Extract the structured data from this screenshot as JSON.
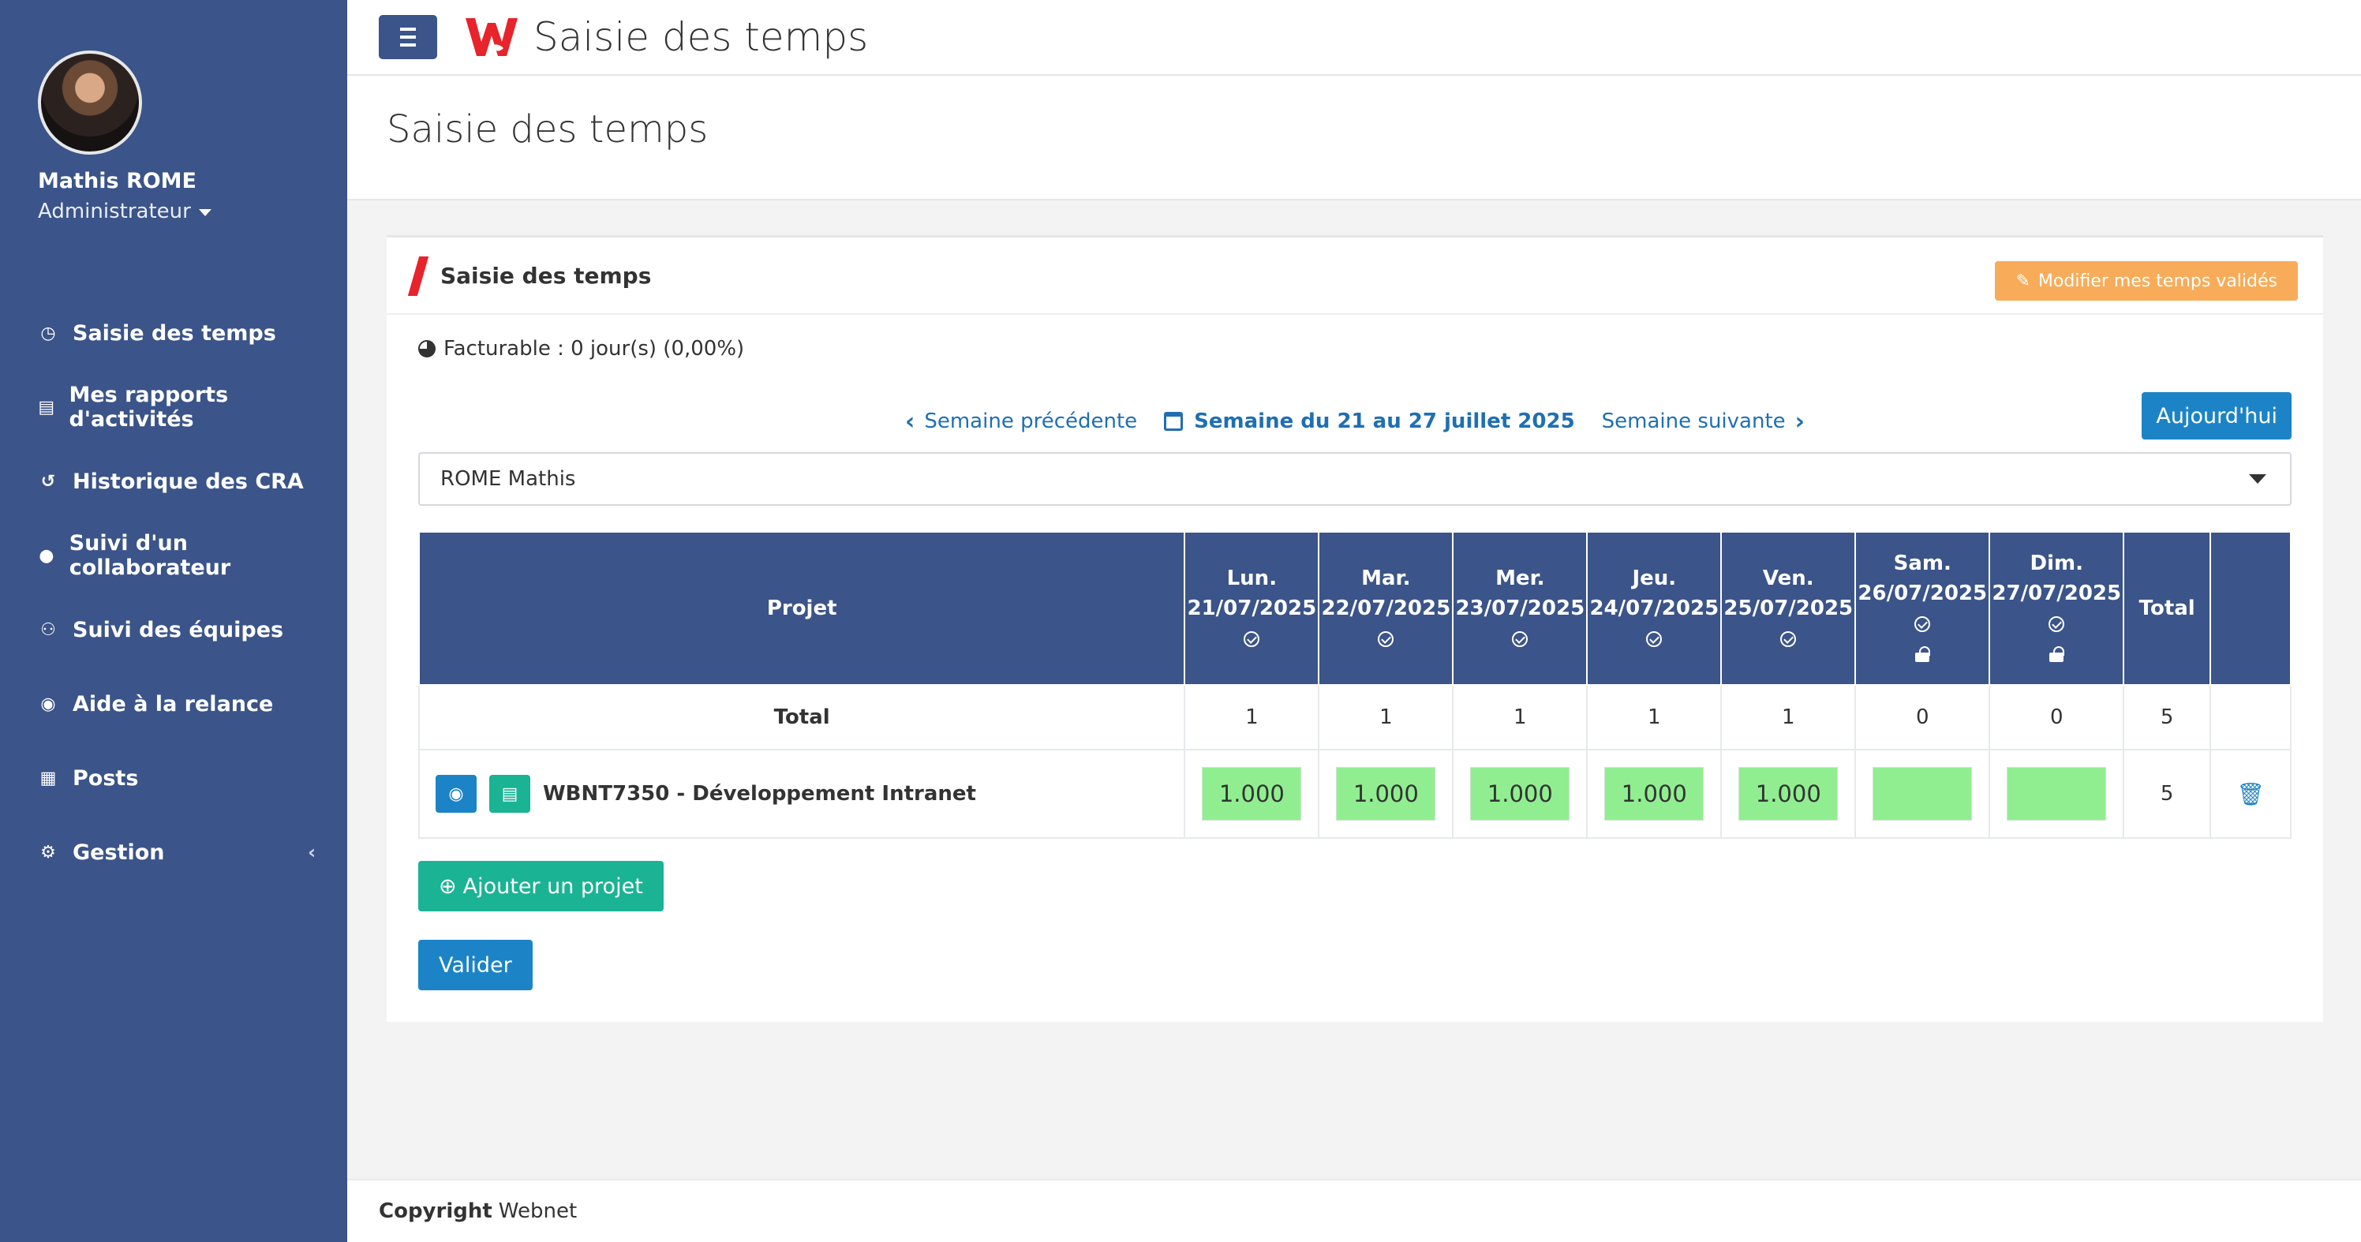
{
  "user": {
    "name": "Mathis ROME",
    "role": "Administrateur"
  },
  "sidebar": {
    "items": [
      {
        "label": "Saisie des temps",
        "icon": "clock-icon"
      },
      {
        "label": "Mes rapports d'activités",
        "icon": "file-icon"
      },
      {
        "label": "Historique des CRA",
        "icon": "history-icon"
      },
      {
        "label": "Suivi d'un collaborateur",
        "icon": "user-icon"
      },
      {
        "label": "Suivi des équipes",
        "icon": "users-icon"
      },
      {
        "label": "Aide à la relance",
        "icon": "eye-icon"
      },
      {
        "label": "Posts",
        "icon": "newspaper-icon"
      },
      {
        "label": "Gestion",
        "icon": "gear-icon"
      }
    ]
  },
  "topbar": {
    "title": "Saisie des temps"
  },
  "page": {
    "title": "Saisie des temps"
  },
  "card": {
    "title": "Saisie des temps",
    "edit_button": "Modifier mes temps validés",
    "billable": "Facturable : 0 jour(s) (0,00%)",
    "week": {
      "prev": "Semaine précédente",
      "current": "Semaine du 21 au 27 juillet 2025",
      "next": "Semaine suivante",
      "today": "Aujourd'hui"
    },
    "collaborator_select": "ROME Mathis",
    "table": {
      "headers": {
        "project": "Projet",
        "days": [
          {
            "day": "Lun.",
            "date": "21/07/2025"
          },
          {
            "day": "Mar.",
            "date": "22/07/2025"
          },
          {
            "day": "Mer.",
            "date": "23/07/2025"
          },
          {
            "day": "Jeu.",
            "date": "24/07/2025"
          },
          {
            "day": "Ven.",
            "date": "25/07/2025"
          },
          {
            "day": "Sam.",
            "date": "26/07/2025"
          },
          {
            "day": "Dim.",
            "date": "27/07/2025"
          }
        ],
        "total": "Total"
      },
      "total_row": {
        "label": "Total",
        "values": [
          "1",
          "1",
          "1",
          "1",
          "1",
          "0",
          "0"
        ],
        "total": "5"
      },
      "project_row": {
        "name": "WBNT7350 - Développement Intranet",
        "values": [
          "1.000",
          "1.000",
          "1.000",
          "1.000",
          "1.000",
          "",
          ""
        ],
        "total": "5"
      }
    },
    "add_project": "Ajouter un projet",
    "submit": "Valider"
  },
  "footer": {
    "label": "Copyright",
    "company": "Webnet"
  },
  "colors": {
    "sidebar": "#3b5489",
    "primary": "#1c84c6",
    "success": "#1ab394",
    "warning": "#f8ac59",
    "cell_green": "#90ee90",
    "brand_red": "#e8232b"
  }
}
